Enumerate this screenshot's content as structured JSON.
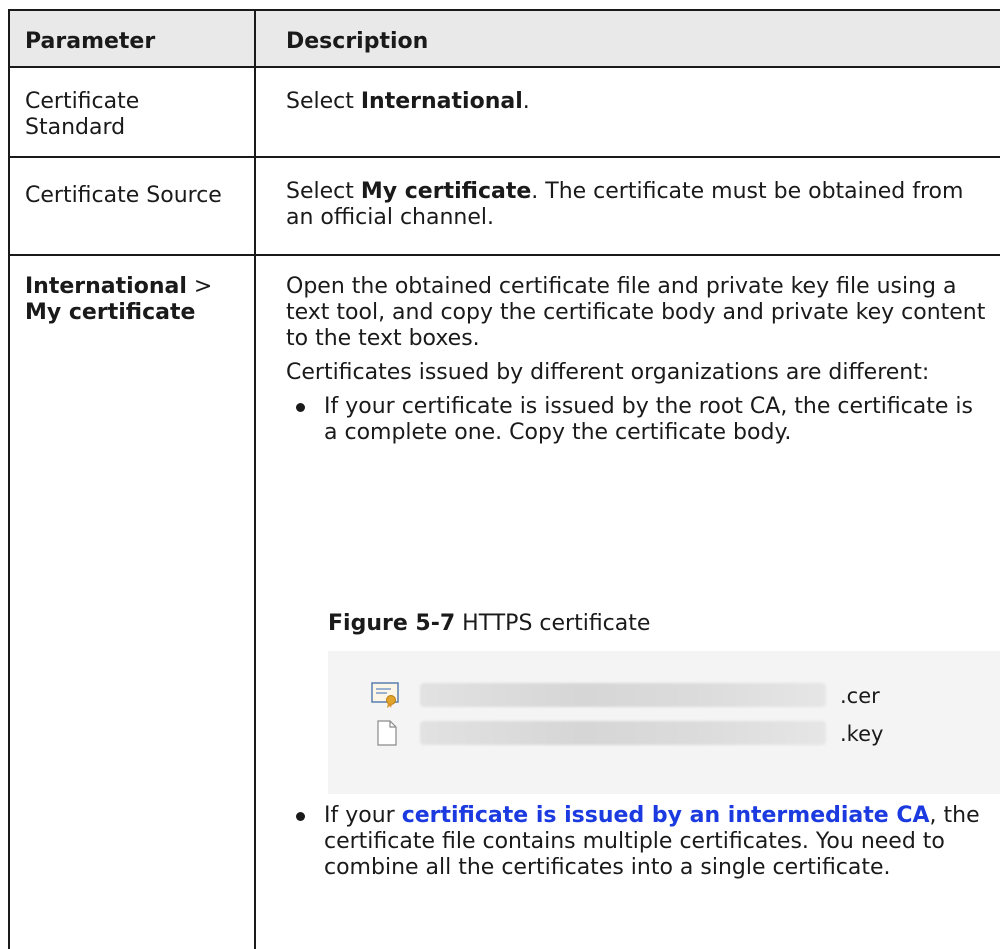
{
  "header": {
    "col1": "Parameter",
    "col2": "Description"
  },
  "rows": [
    {
      "param": "Certificate Standard",
      "desc_pre": "Select ",
      "desc_bold": "International",
      "desc_post": "."
    },
    {
      "param": "Certificate Source",
      "desc_pre": "Select ",
      "desc_bold": "My certificate",
      "desc_post": ". The certificate must be obtained from an official channel."
    },
    {
      "param_bold_1": "International",
      "param_sep": " > ",
      "param_bold_2": "My certificate",
      "p1": "Open the obtained certificate file and private key file using a text tool, and copy the certificate body and private key content to the text boxes.",
      "p2": "Certificates issued by different organizations are different:",
      "bullet1": "If your certificate is issued by the root CA, the certificate is a complete one. Copy the certificate body.",
      "figure_label": "Figure 5-7",
      "figure_title": " HTTPS certificate",
      "figure_files": [
        ".cer",
        ".key"
      ],
      "bullet2_pre": "If your ",
      "bullet2_link": "certificate is issued by an intermediate CA",
      "bullet2_post": ", the certificate file contains multiple certificates. You need to combine all the certificates into a single certificate."
    }
  ],
  "colors": {
    "link": "#1b3adf",
    "header_bg": "#e9e9e9",
    "border": "#1a1a1a"
  }
}
